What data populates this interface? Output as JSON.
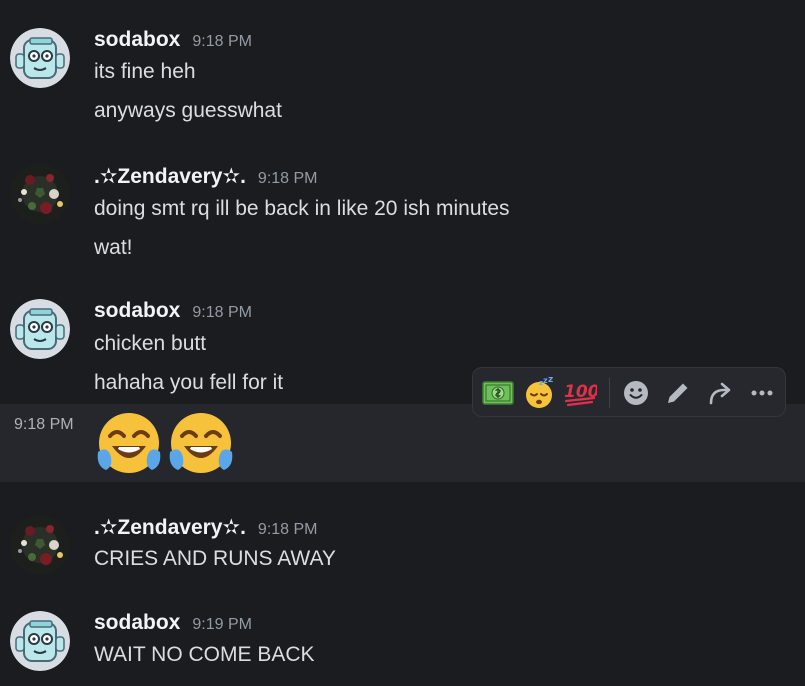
{
  "messages": [
    {
      "username": "sodabox",
      "timestamp": "9:18 PM",
      "avatar_icon": "sodabox-avatar-icon",
      "lines": [
        "its fine heh",
        "anyways guesswhat"
      ]
    },
    {
      "username": ".✫Zendavery✫.",
      "timestamp": "9:18 PM",
      "avatar_icon": "zendavery-avatar-icon",
      "lines": [
        "doing smt rq ill be back in like 20 ish minutes",
        "wat!"
      ]
    },
    {
      "username": "sodabox",
      "timestamp": "9:18 PM",
      "avatar_icon": "sodabox-avatar-icon",
      "lines": [
        "chicken butt",
        "hahaha you fell for it"
      ]
    },
    {
      "username": ".✫Zendavery✫.",
      "timestamp": "9:18 PM",
      "avatar_icon": "zendavery-avatar-icon",
      "lines": [
        "CRIES AND RUNS AWAY"
      ]
    },
    {
      "username": "sodabox",
      "timestamp": "9:19 PM",
      "avatar_icon": "sodabox-avatar-icon",
      "lines": [
        "WAIT NO COME BACK"
      ]
    }
  ],
  "hovered_message": {
    "side_timestamp": "9:18 PM",
    "emojis": [
      "face-with-tears-of-joy-emoji",
      "face-with-tears-of-joy-emoji"
    ]
  },
  "toolbar": {
    "quick_reactions": [
      "dollar-banknote-emoji",
      "sleeping-face-emoji",
      "hundred-points-emoji"
    ],
    "actions": [
      "add-reaction-icon",
      "edit-icon",
      "forward-icon",
      "more-icon"
    ]
  },
  "colors": {
    "background": "#1b1c20",
    "hover_row": "#26272c",
    "username": "#f2f3f5",
    "text": "#dbdee1",
    "timestamp": "#949ba4",
    "toolbar_bg": "#27282d"
  }
}
